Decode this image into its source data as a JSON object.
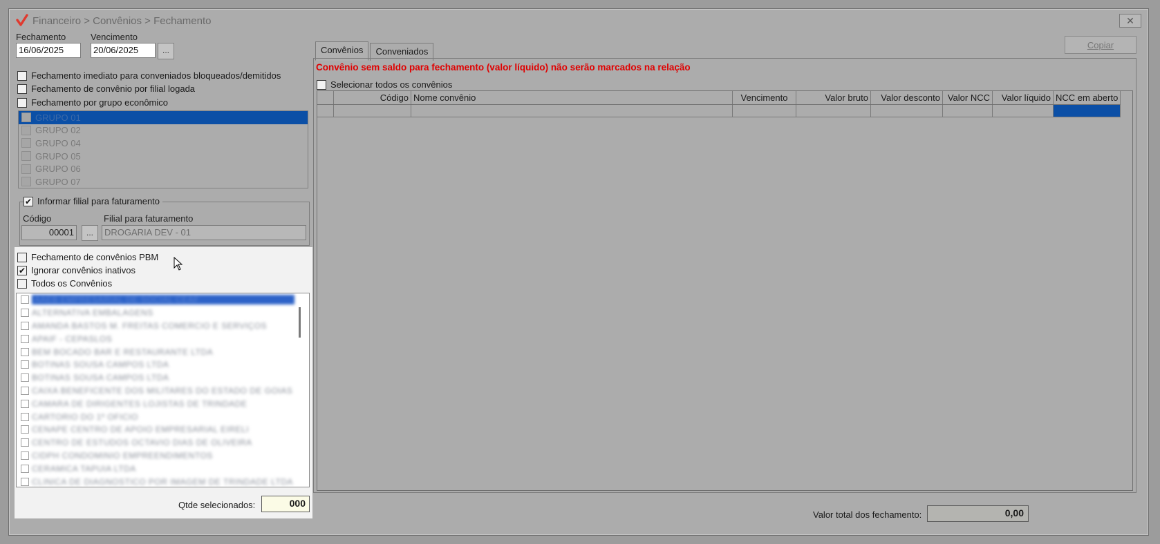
{
  "window": {
    "title": "Financeiro > Convênios > Fechamento",
    "close_symbol": "✕"
  },
  "dates": {
    "fechamento_label": "Fechamento",
    "fechamento_value": "16/06/2025",
    "vencimento_label": "Vencimento",
    "vencimento_value": "20/06/2025",
    "more_button": "..."
  },
  "options": {
    "fechamento_imediato": {
      "label": "Fechamento imediato para conveniados bloqueados/demitidos",
      "checked": false
    },
    "fechamento_filial": {
      "label": "Fechamento de convênio por filial logada",
      "checked": false
    },
    "fechamento_grupo": {
      "label": "Fechamento por grupo econômico",
      "checked": false
    }
  },
  "grupos": [
    {
      "label": "GRUPO 01",
      "selected": true
    },
    {
      "label": "GRUPO 02",
      "selected": false
    },
    {
      "label": "GRUPO 04",
      "selected": false
    },
    {
      "label": "GRUPO 05",
      "selected": false
    },
    {
      "label": "GRUPO 06",
      "selected": false
    },
    {
      "label": "GRUPO 07",
      "selected": false
    }
  ],
  "filial": {
    "legend": "Informar filial para faturamento",
    "checked": true,
    "codigo_label": "Código",
    "codigo_value": "00001",
    "more_button": "...",
    "filial_label": "Filial para faturamento",
    "filial_value": "DROGARIA DEV - 01"
  },
  "convenio_options": {
    "pbm": {
      "label": "Fechamento de convênios PBM",
      "checked": false
    },
    "ignorar_inativos": {
      "label": "Ignorar convênios inativos",
      "checked": true
    },
    "todos": {
      "label": "Todos os Convênios",
      "checked": false
    }
  },
  "convenios": [
    "AAEB EMPRESARIAL DE SOCIAL CEAF",
    "ALTERNATIVA EMBALAGENS",
    "AMANDA BASTOS M. FREITAS COMERCIO E SERVIÇOS",
    "APAIF - CEPASLOS",
    "BEM BOCADO BAR E RESTAURANTE LTDA",
    "BOTINAS SOUSA CAMPOS LTDA",
    "BOTINAS SOUSA CAMPOS LTDA",
    "CAIXA BENEFICENTE DOS MILITARES DO ESTADO DE GOIAS",
    "CAMARA DE DIRIGENTES LOJISTAS DE TRINDADE",
    "CARTORIO DO 1º OFICIO",
    "CENAPE CENTRO DE APOIO EMPRESARIAL EIRELI",
    "CENTRO DE ESTUDOS OCTAVIO DIAS DE OLIVEIRA",
    "CIDPH CONDOMINIO EMPREENDIMENTOS",
    "CERAMICA TAPUIA LTDA",
    "CLINICA DE DIAGNOSTICO POR IMAGEM DE TRINDADE LTDA"
  ],
  "qtde": {
    "label": "Qtde selecionados:",
    "value": "000"
  },
  "tabs": [
    {
      "label": "Convênios",
      "active": true
    },
    {
      "label": "Conveniados",
      "active": false
    }
  ],
  "copy_button": "Copiar",
  "warning": "Convênio sem saldo para fechamento (valor líquido) não serão marcados na relação",
  "select_all": {
    "label": "Selecionar todos os convênios",
    "checked": false
  },
  "grid": {
    "columns": [
      "",
      "Código",
      "Nome convênio",
      "Vencimento",
      "Valor bruto",
      "Valor desconto",
      "Valor NCC",
      "Valor líquido",
      "NCC em aberto"
    ],
    "rows": [
      [
        "",
        "",
        "",
        "",
        "",
        "",
        "",
        "",
        ""
      ]
    ]
  },
  "total": {
    "label": "Valor total dos fechamento:",
    "value": "0,00"
  },
  "colors": {
    "selection": "#0b4fa6",
    "warning": "#e00000",
    "logo": "#e03a2f"
  }
}
